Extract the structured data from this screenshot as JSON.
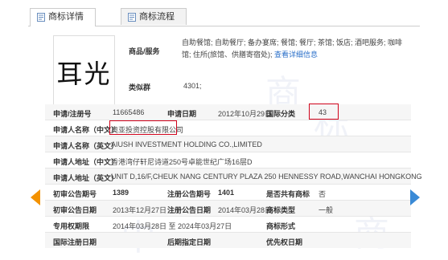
{
  "tabs": [
    {
      "label": "商标详情"
    },
    {
      "label": "商标流程"
    }
  ],
  "logo": {
    "text": "耳光"
  },
  "goods": {
    "label": "商品/服务",
    "value": "自助餐馆; 自助餐厅; 备办宴席; 餐馆; 餐厅; 茶馆; 饭店; 酒吧服务; 咖啡馆; 住所(旅馆、供膳寄宿处);",
    "link": "查看详细信息"
  },
  "similar_group": {
    "label": "类似群",
    "value": "4301;"
  },
  "fields": {
    "reg_no_label": "申请/注册号",
    "reg_no": "11665486",
    "app_date_label": "申请日期",
    "app_date": "2012年10月29日",
    "intl_class_label": "国际分类",
    "intl_class": "43",
    "name_cn_label": "申请人名称（中文）",
    "name_cn": "奥亚投资控股有限公司",
    "name_en_label": "申请人名称（英文）",
    "name_en": "AIUSH INVESTMENT HOLDING CO.,LIMITED",
    "addr_cn_label": "申请人地址（中文）",
    "addr_cn": "香港湾仔轩尼诗道250号卓能世纪广场16层D",
    "addr_en_label": "申请人地址（英文）",
    "addr_en": "UNIT D,16/F,CHEUK NANG CENTURY PLAZA 250 HENNESSY ROAD,WANCHAI HONGKONG",
    "prelim_no_label": "初审公告期号",
    "prelim_no": "1389",
    "reg_pub_no_label": "注册公告期号",
    "reg_pub_no": "1401",
    "shared_label": "是否共有商标",
    "shared": "否",
    "prelim_date_label": "初审公告日期",
    "prelim_date": "2013年12月27日",
    "reg_pub_date_label": "注册公告日期",
    "reg_pub_date": "2014年03月28日",
    "tm_type_label": "商标类型",
    "tm_type": "一般",
    "validity_label": "专用权期限",
    "validity": "2014年03月28日 至 2024年03月27日",
    "tm_form_label": "商标形式",
    "tm_form": "",
    "intl_reg_date_label": "国际注册日期",
    "intl_reg_date": "",
    "later_date_label": "后期指定日期",
    "later_date": "",
    "priority_date_label": "优先权日期",
    "priority_date": ""
  },
  "colors": {
    "highlight": "#d0021b",
    "link": "#2a6fc9",
    "prev_arrow": "#f39200",
    "next_arrow": "#3a8ad6"
  },
  "nav": {
    "prev_icon": "chevron-left-icon",
    "next_icon": "chevron-right-icon"
  }
}
